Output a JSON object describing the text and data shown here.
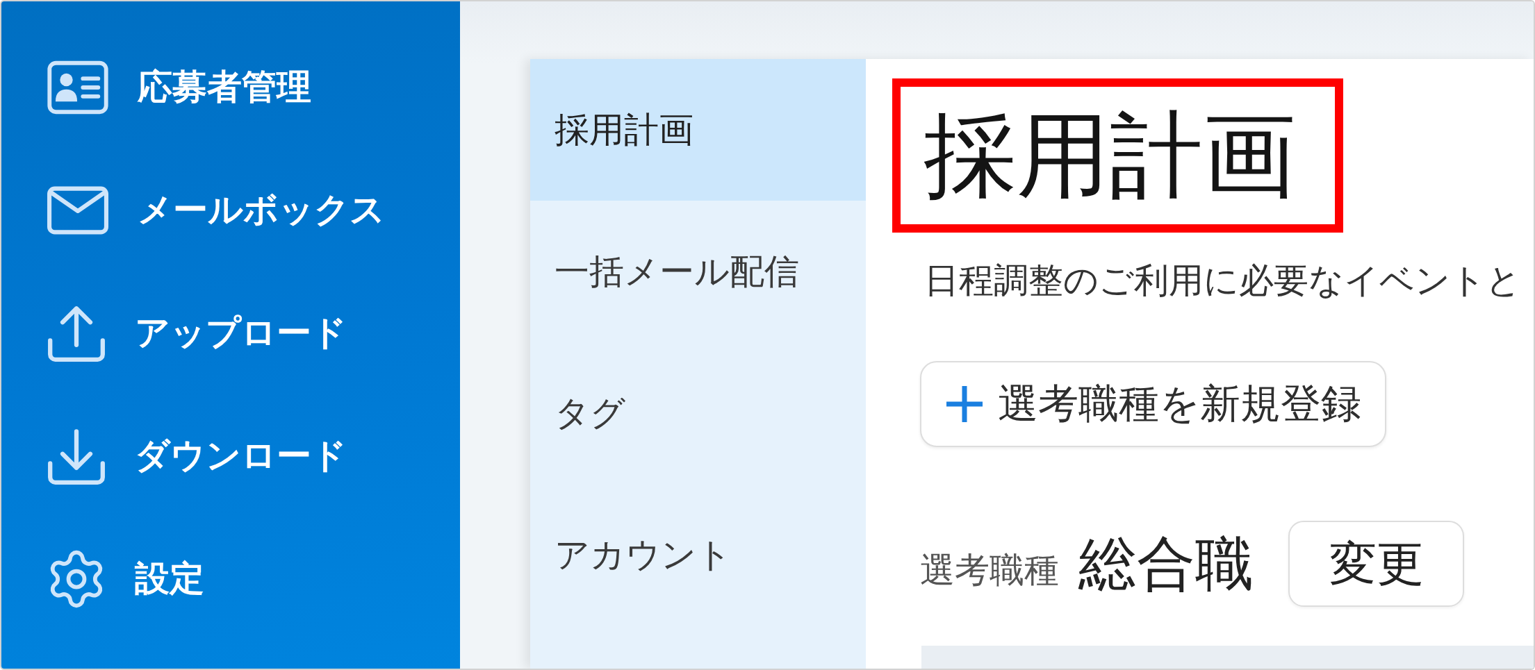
{
  "sidebar": {
    "items": [
      {
        "label": "応募者管理",
        "selected": false
      },
      {
        "label": "メールボックス",
        "selected": false
      },
      {
        "label": "アップロード",
        "selected": false
      },
      {
        "label": "ダウンロード",
        "selected": false
      },
      {
        "label": "設定",
        "selected": false
      }
    ]
  },
  "settings_nav": {
    "items": [
      {
        "label": "採用計画",
        "selected": true
      },
      {
        "label": "一括メール配信",
        "selected": false
      },
      {
        "label": "タグ",
        "selected": false
      },
      {
        "label": "アカウント",
        "selected": false
      }
    ]
  },
  "main": {
    "title": {
      "text": "採用計画",
      "highlighted": true
    },
    "description": "日程調整のご利用に必要なイベントと",
    "add_button": {
      "label": "選考職種を新規登録"
    },
    "job_type": {
      "label": "選考職種",
      "value": "総合職",
      "button": "変更"
    }
  }
}
